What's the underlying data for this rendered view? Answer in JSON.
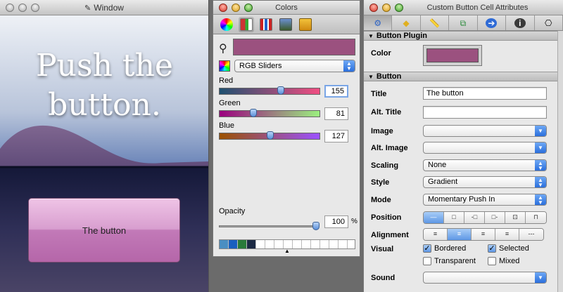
{
  "window1": {
    "title": "Window",
    "headline_line1": "Push the",
    "headline_line2": "button.",
    "button_label": "The button"
  },
  "colors_panel": {
    "title": "Colors",
    "mode_select": "RGB Sliders",
    "sliders": [
      {
        "label": "Red",
        "value": "155",
        "fraction": 0.61
      },
      {
        "label": "Green",
        "value": "81",
        "fraction": 0.32
      },
      {
        "label": "Blue",
        "value": "127",
        "fraction": 0.5
      }
    ],
    "opacity_label": "Opacity",
    "opacity_value": "100",
    "opacity_unit": "%",
    "current_color": "#9b517f",
    "swatches": [
      "#4a8ec2",
      "#1a5fbf",
      "#2a7a3a",
      "#1c2a44"
    ]
  },
  "inspector": {
    "title": "Custom Button Cell Attributes",
    "tabs": [
      "attributes-icon",
      "effects-icon",
      "size-icon",
      "bindings-icon",
      "connections-icon",
      "info-icon",
      "identity-icon"
    ],
    "plugin_section": "Button Plugin",
    "color_label": "Color",
    "button_section": "Button",
    "title_label": "Title",
    "title_value": "The button",
    "alt_title_label": "Alt. Title",
    "image_label": "Image",
    "alt_image_label": "Alt. Image",
    "scaling_label": "Scaling",
    "scaling_value": "None",
    "style_label": "Style",
    "style_value": "Gradient",
    "mode_label": "Mode",
    "mode_value": "Momentary Push In",
    "position_label": "Position",
    "alignment_label": "Alignment",
    "visual_label": "Visual",
    "bordered_label": "Bordered",
    "selected_label": "Selected",
    "transparent_label": "Transparent",
    "mixed_label": "Mixed",
    "sound_label": "Sound"
  }
}
